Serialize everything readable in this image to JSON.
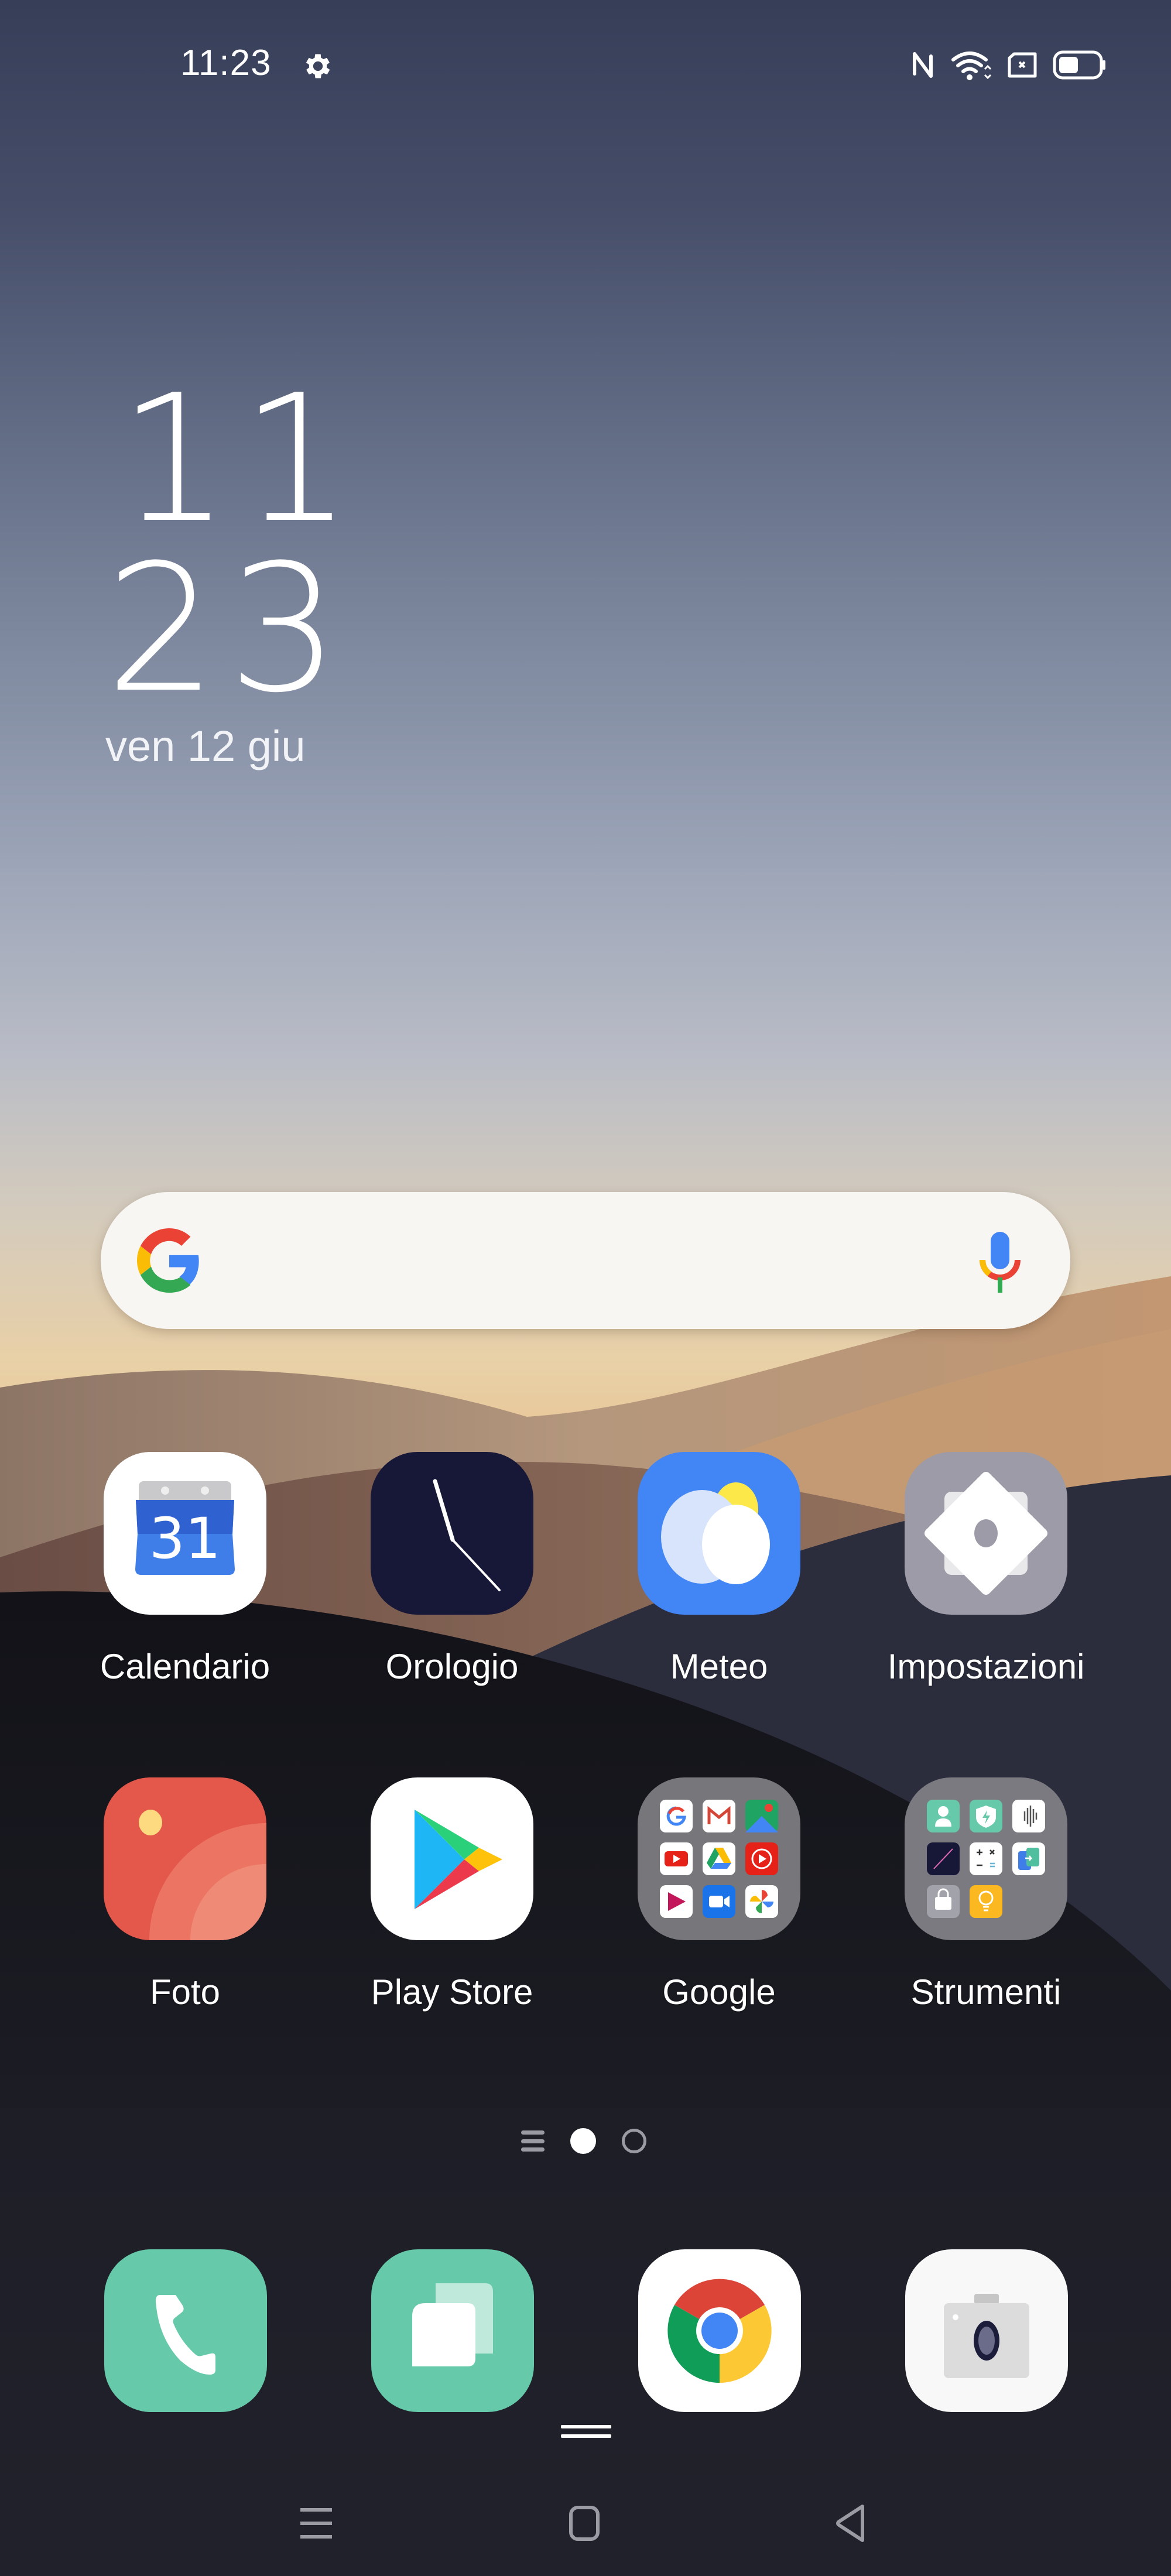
{
  "status_bar": {
    "time": "11:23",
    "left_icons": [
      "settings-gear-icon"
    ],
    "right_icons": [
      "nfc-icon",
      "wifi-icon",
      "no-sim-icon",
      "battery-icon"
    ],
    "battery_level_fraction": 0.45
  },
  "clock_widget": {
    "hours": "11",
    "minutes": "23",
    "date": "ven 12 giu"
  },
  "search_widget": {
    "logo": "google-g-icon",
    "voice_icon": "microphone-icon",
    "placeholder": ""
  },
  "apps": [
    {
      "label": "Calendario",
      "icon": "calendar-icon",
      "icon_text": "31"
    },
    {
      "label": "Orologio",
      "icon": "clock-icon"
    },
    {
      "label": "Meteo",
      "icon": "weather-icon"
    },
    {
      "label": "Impostazioni",
      "icon": "settings-icon"
    },
    {
      "label": "Foto",
      "icon": "photos-icon"
    },
    {
      "label": "Play Store",
      "icon": "play-store-icon"
    },
    {
      "label": "Google",
      "icon": "folder-icon",
      "folder_contents": [
        "google-icon",
        "gmail-icon",
        "maps-icon",
        "youtube-icon",
        "drive-icon",
        "youtube-music-icon",
        "play-movies-icon",
        "duo-icon",
        "google-photos-icon"
      ]
    },
    {
      "label": "Strumenti",
      "icon": "folder-icon",
      "folder_contents": [
        "contacts-icon",
        "phone-manager-icon",
        "recorder-icon",
        "compass-icon",
        "calculator-icon",
        "clone-phone-icon",
        "app-market-icon",
        "tips-icon"
      ]
    }
  ],
  "page_indicator": {
    "pages": 2,
    "current_page": 1,
    "list_icon": "app-drawer-list-icon"
  },
  "dock": [
    {
      "name": "phone",
      "icon": "phone-icon"
    },
    {
      "name": "messages",
      "icon": "messages-icon"
    },
    {
      "name": "chrome",
      "icon": "chrome-icon"
    },
    {
      "name": "camera",
      "icon": "camera-icon"
    }
  ],
  "nav_bar": {
    "buttons": [
      "recents-button",
      "home-button",
      "back-button"
    ]
  },
  "colors": {
    "accent_green": "#66c9a9",
    "calendar_blue": "#3f7ee8",
    "weather_blue": "#4285f4",
    "settings_gray": "#9c9ba7",
    "photos_red": "#e4574b",
    "clock_navy": "#171838"
  }
}
